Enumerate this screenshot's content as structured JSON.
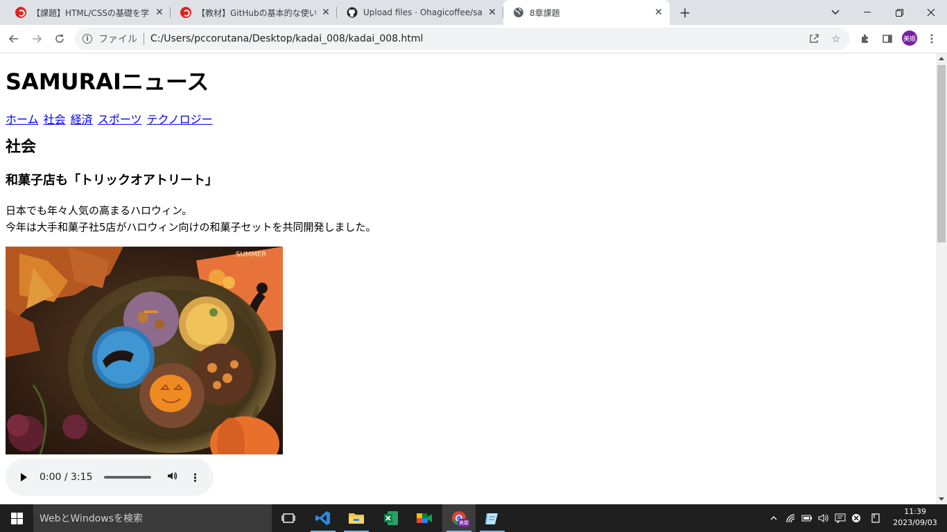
{
  "browser": {
    "tabs": [
      {
        "title": "【課題】HTML/CSSの基礎を学ぼう -",
        "icon": "samurai-icon",
        "active": false
      },
      {
        "title": "【教材】GitHubの基本的な使い方を",
        "icon": "samurai-icon",
        "active": false
      },
      {
        "title": "Upload files · Ohagicoffee/samur",
        "icon": "github-icon",
        "active": false
      },
      {
        "title": "8章課題",
        "icon": "globe-icon",
        "active": true
      }
    ],
    "address": {
      "scheme_label": "ファイル",
      "url": "C:/Users/pccorutana/Desktop/kadai_008/kadai_008.html"
    },
    "profile_label": "美姫"
  },
  "page": {
    "site_title": "SAMURAIニュース",
    "nav": [
      "ホーム",
      "社会",
      "経済",
      "スポーツ",
      "テクノロジー"
    ],
    "section": "社会",
    "article_title": "和菓子店も「トリックオアトリート」",
    "body_lines": [
      "日本でも年々人気の高まるハロウィン。",
      "今年は大手和菓子社5店がハロウィン向けの和菓子セットを共同開発しました。"
    ],
    "image_box_text": "SUMMER",
    "audio": {
      "time": "0:00 / 3:15",
      "progress": 0
    }
  },
  "taskbar": {
    "search_placeholder": "WebとWindowsを検索",
    "clock_time": "11:39",
    "clock_date": "2023/09/03",
    "chrome_badge": "美姫"
  },
  "colors": {
    "link": "#0000ee",
    "tabstrip": "#dee1e6",
    "taskbar": "#1f1f1f",
    "profile": "#7b1fa2"
  }
}
